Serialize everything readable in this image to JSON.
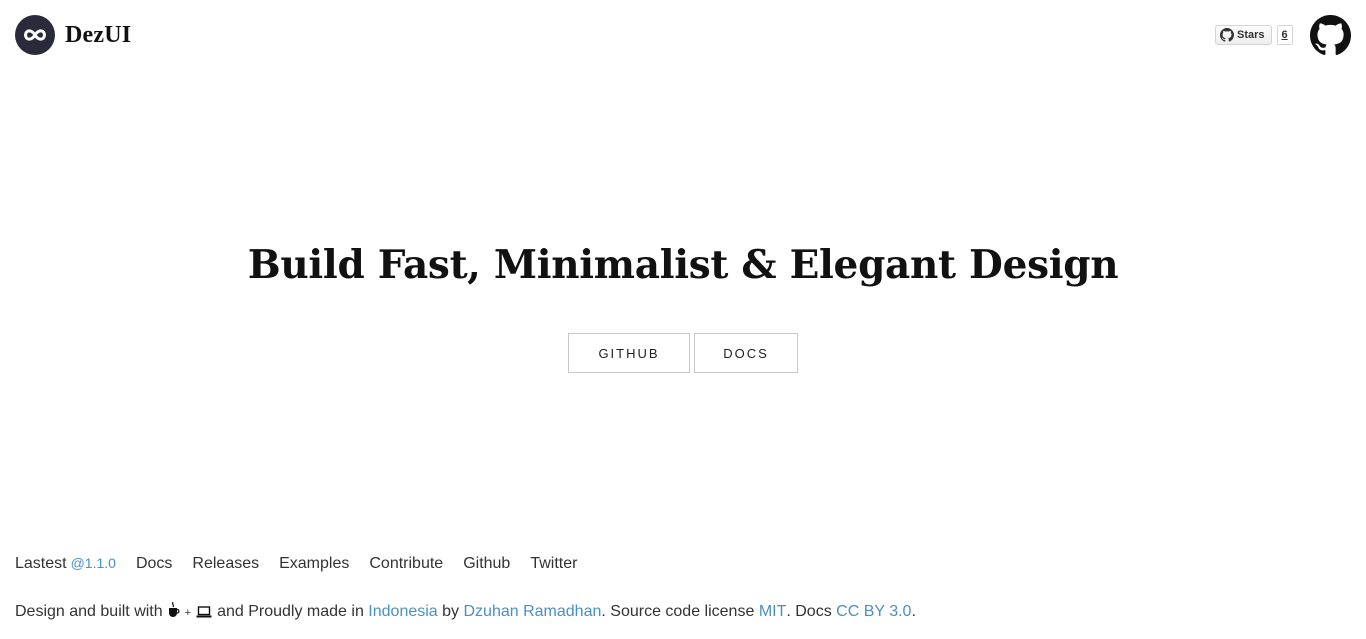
{
  "header": {
    "brand": "DezUI",
    "github_stars": {
      "label": "Stars",
      "count": "6"
    }
  },
  "hero": {
    "title": "Build Fast, Minimalist & Elegant Design",
    "buttons": {
      "github": "GITHUB",
      "docs": "DOCS"
    }
  },
  "footer": {
    "nav": {
      "lastest_label": "Lastest",
      "version": "@1.1.0",
      "items": [
        "Docs",
        "Releases",
        "Examples",
        "Contribute",
        "Github",
        "Twitter"
      ]
    },
    "credits": {
      "prefix": "Design and built with",
      "plus": "+",
      "made_in": "and Proudly made in",
      "country": "Indonesia",
      "by": "by",
      "author": "Dzuhan Ramadhan",
      "license_text": ". Source code license",
      "license": "MIT",
      "docs_text": ". Docs",
      "docs_license": "CC BY 3.0",
      "end": "."
    }
  },
  "colors": {
    "link": "#4a90c2",
    "logo_bg": "#2b2a3a",
    "text": "#333333"
  }
}
